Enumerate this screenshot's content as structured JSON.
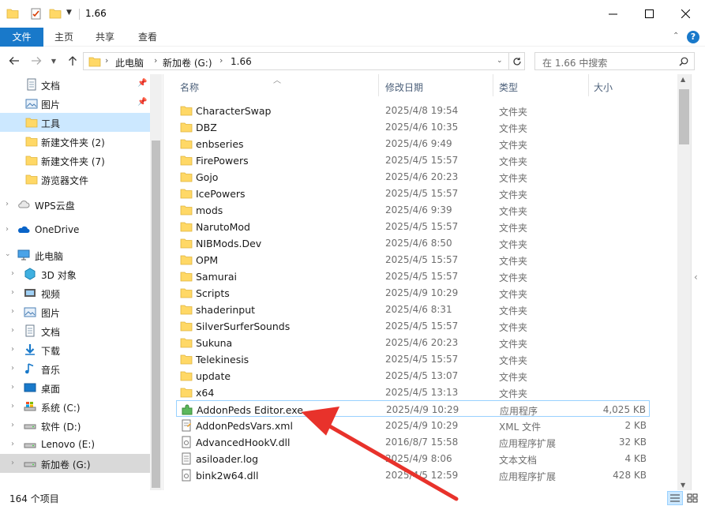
{
  "window": {
    "title": "1.66",
    "minimize_icon": "minimize-icon",
    "maximize_icon": "maximize-icon",
    "close_icon": "close-icon"
  },
  "ribbon": {
    "tabs": [
      "文件",
      "主页",
      "共享",
      "查看"
    ],
    "accent": "#1979ca"
  },
  "address": {
    "crumbs": [
      "此电脑",
      "新加卷 (G:)",
      "1.66"
    ],
    "search_placeholder": "在 1.66 中搜索"
  },
  "nav": {
    "quick_access": [
      "文档",
      "图片",
      "工具",
      "新建文件夹 (2)",
      "新建文件夹 (7)",
      "游览器文件"
    ],
    "wps": "WPS云盘",
    "onedrive": "OneDrive",
    "this_pc": "此电脑",
    "pc_items": [
      "3D 对象",
      "视频",
      "图片",
      "文档",
      "下载",
      "音乐",
      "桌面",
      "系统 (C:)",
      "软件 (D:)",
      "Lenovo (E:)",
      "新加卷 (G:)"
    ]
  },
  "columns": {
    "name": "名称",
    "date": "修改日期",
    "type": "类型",
    "size": "大小"
  },
  "files": [
    {
      "name": "CharacterSwap",
      "date": "2025/4/8 19:54",
      "type": "文件夹",
      "size": "",
      "kind": "folder"
    },
    {
      "name": "DBZ",
      "date": "2025/4/6 10:35",
      "type": "文件夹",
      "size": "",
      "kind": "folder"
    },
    {
      "name": "enbseries",
      "date": "2025/4/6 9:49",
      "type": "文件夹",
      "size": "",
      "kind": "folder"
    },
    {
      "name": "FirePowers",
      "date": "2025/4/5 15:57",
      "type": "文件夹",
      "size": "",
      "kind": "folder"
    },
    {
      "name": "Gojo",
      "date": "2025/4/6 20:23",
      "type": "文件夹",
      "size": "",
      "kind": "folder"
    },
    {
      "name": "IcePowers",
      "date": "2025/4/5 15:57",
      "type": "文件夹",
      "size": "",
      "kind": "folder"
    },
    {
      "name": "mods",
      "date": "2025/4/6 9:39",
      "type": "文件夹",
      "size": "",
      "kind": "folder"
    },
    {
      "name": "NarutoMod",
      "date": "2025/4/5 15:57",
      "type": "文件夹",
      "size": "",
      "kind": "folder"
    },
    {
      "name": "NIBMods.Dev",
      "date": "2025/4/6 8:50",
      "type": "文件夹",
      "size": "",
      "kind": "folder"
    },
    {
      "name": "OPM",
      "date": "2025/4/5 15:57",
      "type": "文件夹",
      "size": "",
      "kind": "folder"
    },
    {
      "name": "Samurai",
      "date": "2025/4/5 15:57",
      "type": "文件夹",
      "size": "",
      "kind": "folder"
    },
    {
      "name": "Scripts",
      "date": "2025/4/9 10:29",
      "type": "文件夹",
      "size": "",
      "kind": "folder"
    },
    {
      "name": "shaderinput",
      "date": "2025/4/6 8:31",
      "type": "文件夹",
      "size": "",
      "kind": "folder"
    },
    {
      "name": "SilverSurferSounds",
      "date": "2025/4/5 15:57",
      "type": "文件夹",
      "size": "",
      "kind": "folder"
    },
    {
      "name": "Sukuna",
      "date": "2025/4/6 20:23",
      "type": "文件夹",
      "size": "",
      "kind": "folder"
    },
    {
      "name": "Telekinesis",
      "date": "2025/4/5 15:57",
      "type": "文件夹",
      "size": "",
      "kind": "folder"
    },
    {
      "name": "update",
      "date": "2025/4/5 13:07",
      "type": "文件夹",
      "size": "",
      "kind": "folder"
    },
    {
      "name": "x64",
      "date": "2025/4/5 13:13",
      "type": "文件夹",
      "size": "",
      "kind": "folder"
    },
    {
      "name": "AddonPeds Editor.exe",
      "date": "2025/4/9 10:29",
      "type": "应用程序",
      "size": "4,025 KB",
      "kind": "exe"
    },
    {
      "name": "AddonPedsVars.xml",
      "date": "2025/4/9 10:29",
      "type": "XML 文件",
      "size": "2 KB",
      "kind": "xml"
    },
    {
      "name": "AdvancedHookV.dll",
      "date": "2016/8/7 15:58",
      "type": "应用程序扩展",
      "size": "32 KB",
      "kind": "dll"
    },
    {
      "name": "asiloader.log",
      "date": "2025/4/9 8:06",
      "type": "文本文档",
      "size": "4 KB",
      "kind": "log"
    },
    {
      "name": "bink2w64.dll",
      "date": "2025/4/5 12:59",
      "type": "应用程序扩展",
      "size": "428 KB",
      "kind": "dll"
    }
  ],
  "status": {
    "count": "164 个项目"
  }
}
